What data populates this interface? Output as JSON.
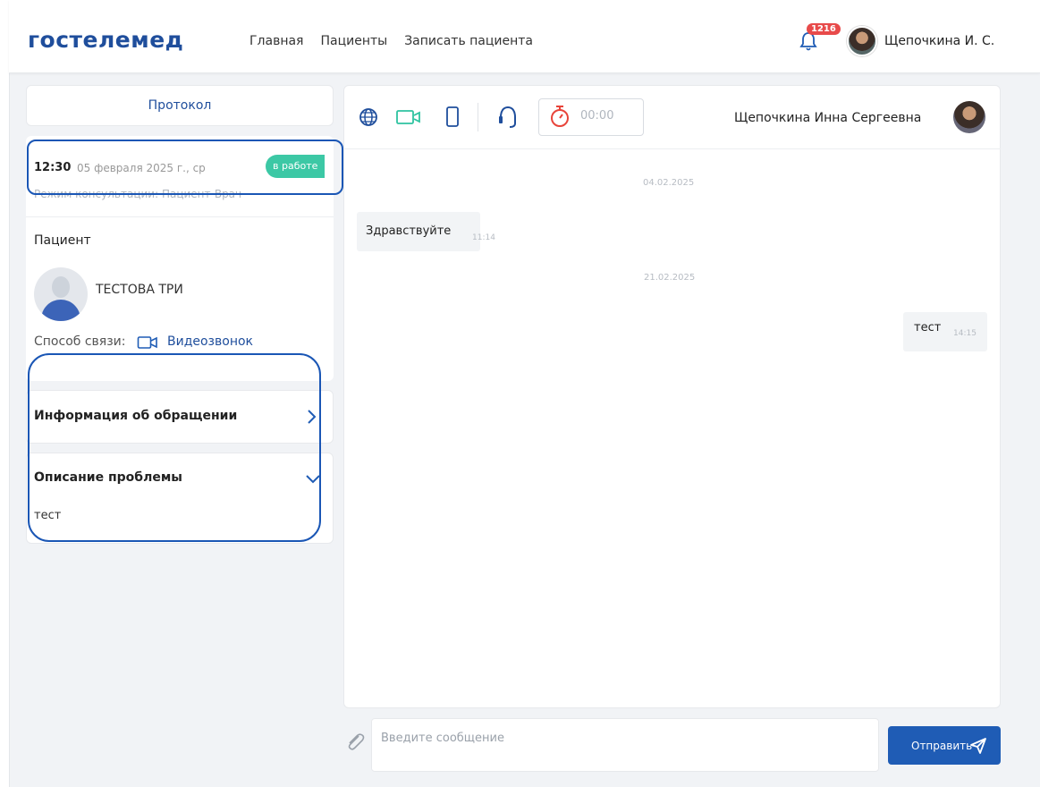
{
  "header": {
    "logo": "гостелемед",
    "nav": [
      "Главная",
      "Пациенты",
      "Записать пациента"
    ],
    "notification_count": "1216",
    "user_name": "Щепочкина И. С."
  },
  "left": {
    "protocol_label": "Протокол",
    "appointment": {
      "time": "12:30",
      "date": "05 февраля 2025 г., ср",
      "status": "в работе",
      "mode": "Режим консультации: Пациент-Врач"
    },
    "patient": {
      "heading": "Пациент",
      "name": "ТЕСТОВА ТРИ",
      "contact_label": "Способ связи:",
      "contact_value": "Видеозвонок"
    },
    "info_title": "Информация об обращении",
    "problem": {
      "title": "Описание проблемы",
      "text": "тест"
    }
  },
  "chat": {
    "timer": "00:00",
    "doctor_name": "Щепочкина Инна Сергеевна",
    "messages": [
      {
        "date": "04.02.2025",
        "text": "Здравствуйте",
        "time": "11:14",
        "side": "left"
      },
      {
        "date": "21.02.2025",
        "text": "тест",
        "time": "14:15",
        "side": "right"
      }
    ],
    "input_placeholder": "Введите сообщение",
    "send_label": "Отправить"
  },
  "colors": {
    "brand": "#1f4e9c",
    "accent_button": "#1f5cb5",
    "status_green": "#3cc8a5",
    "timer_red": "#e8443a",
    "icon_green": "#2ec3a0",
    "badge_red": "#e84a4a",
    "highlight": "#1a56b5"
  },
  "icons": [
    "bell-icon",
    "globe-icon",
    "video-icon",
    "phone-icon",
    "headset-icon",
    "stopwatch-icon",
    "chevron-right-icon",
    "chevron-down-icon",
    "paperclip-icon",
    "send-icon"
  ]
}
